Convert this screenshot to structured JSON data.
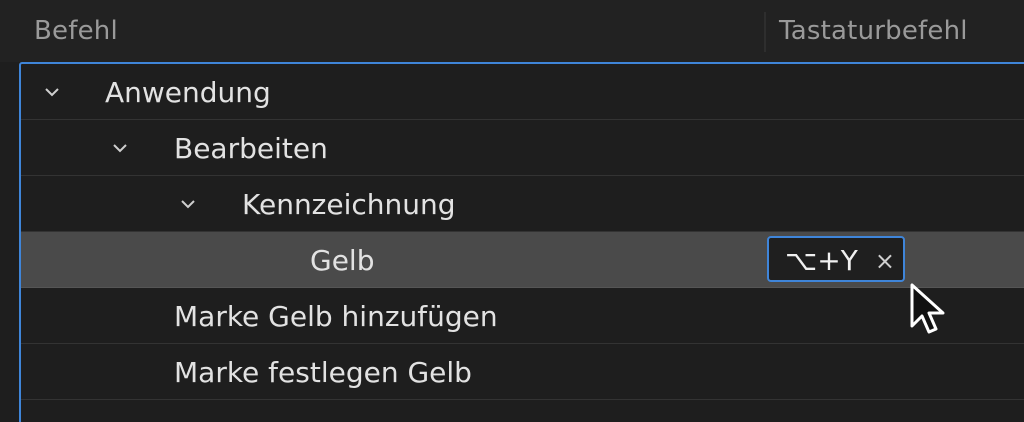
{
  "header": {
    "command_label": "Befehl",
    "shortcut_label": "Tastaturbefehl"
  },
  "tree": {
    "items": [
      {
        "label": "Anwendung",
        "expanded": true
      },
      {
        "label": "Bearbeiten",
        "expanded": true
      },
      {
        "label": "Kennzeichnung",
        "expanded": true
      },
      {
        "label": "Gelb",
        "selected": true,
        "shortcut": "⌥+Y"
      },
      {
        "label": "Marke Gelb hinzufügen"
      },
      {
        "label": "Marke festlegen Gelb"
      }
    ]
  },
  "shortcut_editor": {
    "value": "⌥+Y",
    "clear_icon": "×"
  },
  "colors": {
    "accent": "#3f85d9",
    "selected_row": "#4a4a4a",
    "background": "#1e1e1e"
  },
  "icons": {
    "expand": "chevron-down-icon",
    "clear": "close-icon",
    "pointer": "mouse-pointer-icon"
  }
}
